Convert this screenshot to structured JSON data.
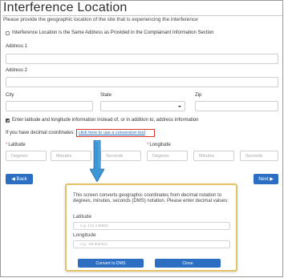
{
  "page": {
    "title": "Interference Location",
    "subtitle": "Please provide the geographic location of the site that is experiencing the interference"
  },
  "form": {
    "same_address_label": "Interference Location is the Same Address as Provided in the Complainant Information Section",
    "address1_label": "Address 1",
    "address1_value": "",
    "address2_label": "Address 2",
    "address2_value": "",
    "city_label": "City",
    "city_value": "",
    "state_label": "State",
    "state_value": "",
    "zip_label": "Zip",
    "zip_value": "",
    "latlong_checkbox_label": "Enter latitude and longitude information instead of, or in addition to, address information",
    "decimal_prompt": "If you have decimal coordinates:",
    "conversion_link": "click here to use a conversion tool",
    "latitude_label": "Latitude",
    "longitude_label": "Longitude",
    "degrees_placeholder": "Degrees",
    "minutes_placeholder": "Minutes",
    "seconds_placeholder": "Seconds"
  },
  "nav": {
    "back_label": "◀ Back",
    "next_label": "Next ▶"
  },
  "dialog": {
    "description": "This screen converts geographic coordinates from decimal notation to degrees, minutes, seconds (DMS) notation. Please enter decimal values:",
    "latitude_label": "Latitude",
    "latitude_placeholder": "e.g. 121.135850",
    "longitude_label": "Longitude",
    "longitude_placeholder": "e.g. -95.654321",
    "convert_label": "Convert to DMS",
    "close_label": "Close"
  },
  "colors": {
    "primary_button": "#2c6ec2",
    "highlight_border": "#d9342b",
    "dialog_border": "#e1c469",
    "arrow_fill": "#3d96d6",
    "required_star": "#d9534f"
  }
}
